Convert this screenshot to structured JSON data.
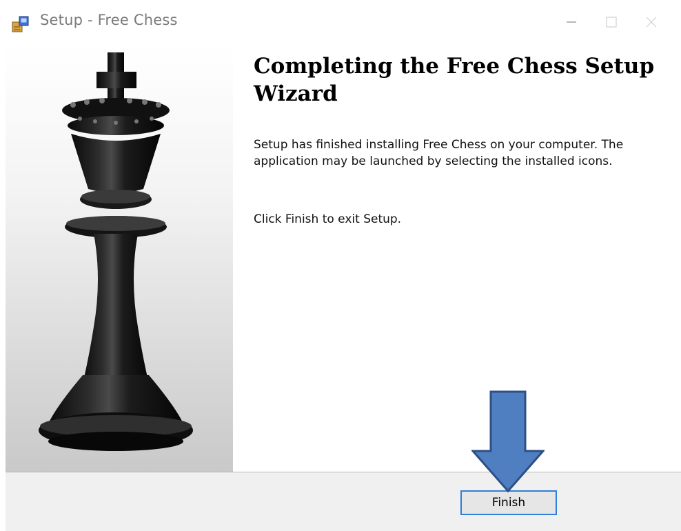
{
  "window": {
    "title": "Setup - Free Chess",
    "icon": "setup-installer-icon",
    "controls": [
      "minimize-icon",
      "maximize-icon",
      "close-icon"
    ]
  },
  "side_image": {
    "icon": "chess-king-image"
  },
  "main": {
    "heading": "Completing the Free Chess Setup Wizard",
    "paragraph1": "Setup has finished installing Free Chess on your computer. The application may be launched by selecting the installed icons.",
    "paragraph2": "Click Finish to exit Setup."
  },
  "footer": {
    "finish_label": "Finish"
  },
  "annotation": {
    "arrow_icon": "down-arrow-annotation",
    "arrow_color": "#4f7fc0"
  }
}
